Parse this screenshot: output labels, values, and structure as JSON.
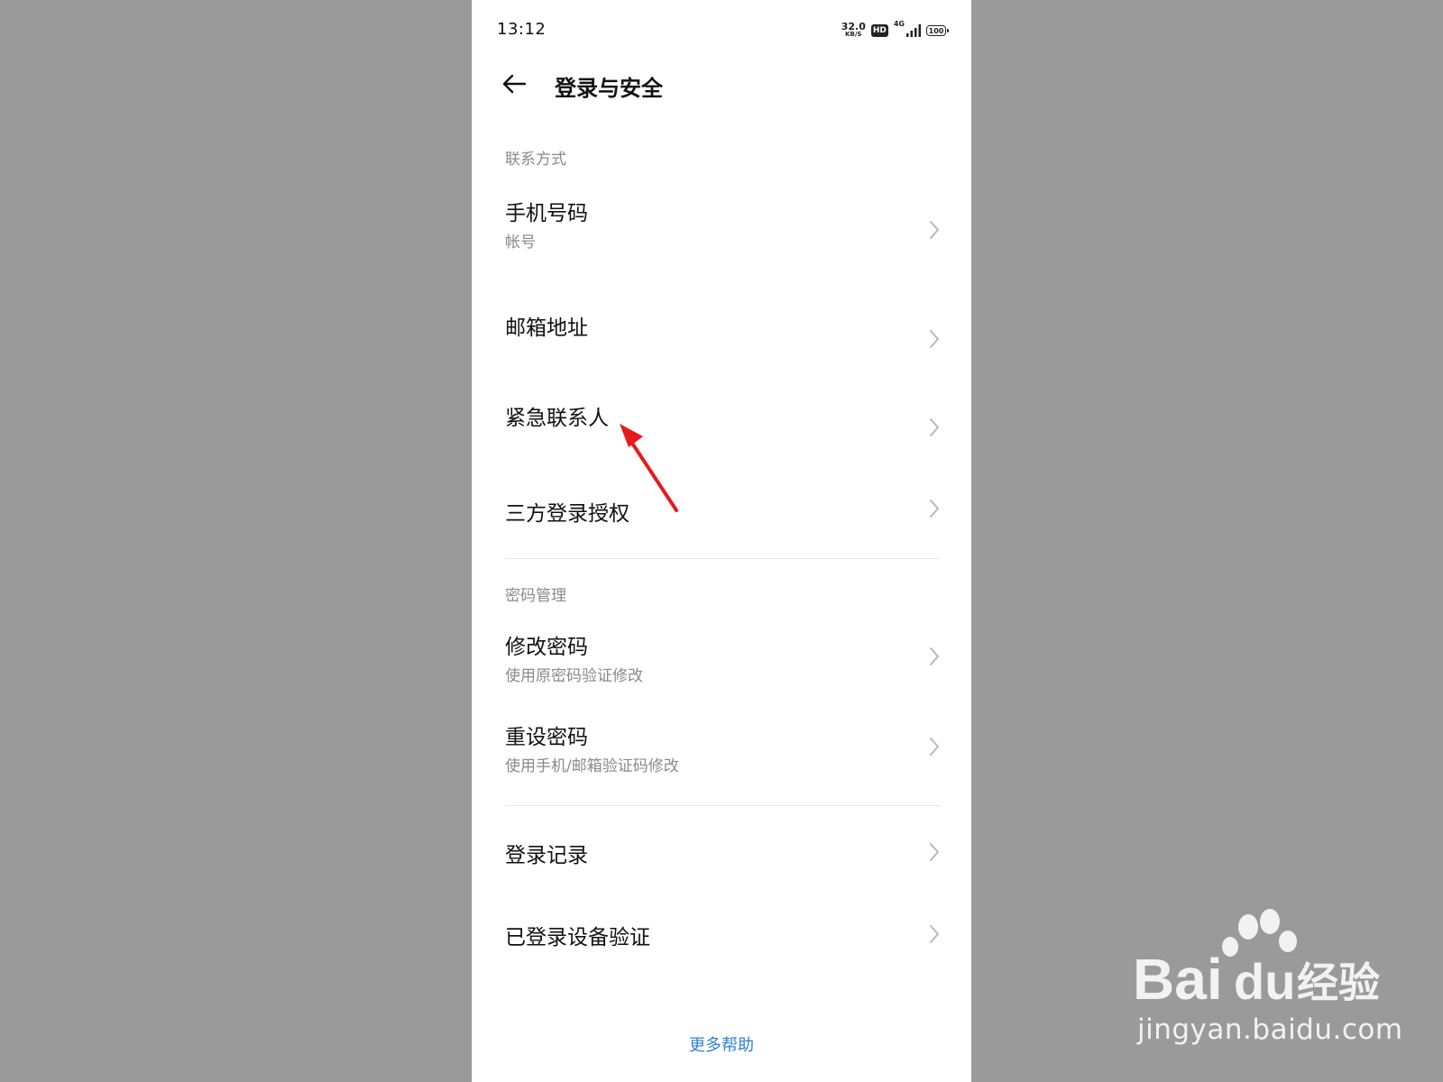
{
  "status_bar": {
    "time": "13:12",
    "net_speed_value": "32.0",
    "net_speed_unit": "KB/S",
    "hd_label": "HD",
    "network_type": "4G",
    "battery_level": "100"
  },
  "header": {
    "back_icon": "arrow-left-icon",
    "title": "登录与安全"
  },
  "sections": {
    "contact": {
      "header": "联系方式",
      "items": [
        {
          "title": "手机号码",
          "subtitle": "帐号"
        },
        {
          "title": "邮箱地址"
        },
        {
          "title": "紧急联系人"
        },
        {
          "title": "三方登录授权"
        }
      ]
    },
    "password": {
      "header": "密码管理",
      "items": [
        {
          "title": "修改密码",
          "subtitle": "使用原密码验证修改"
        },
        {
          "title": "重设密码",
          "subtitle": "使用手机/邮箱验证码修改"
        }
      ]
    },
    "other": {
      "items": [
        {
          "title": "登录记录"
        },
        {
          "title": "已登录设备验证"
        }
      ]
    }
  },
  "more_help": "更多帮助",
  "watermark": {
    "logo_text": "Bai",
    "logo_text_2": "du",
    "logo_suffix": "经验",
    "url": "jingyan.baidu.com"
  },
  "colors": {
    "background": "#9a9a9a",
    "panel": "#ffffff",
    "link": "#2f7fd6",
    "annotation_arrow": "#e8191c"
  }
}
